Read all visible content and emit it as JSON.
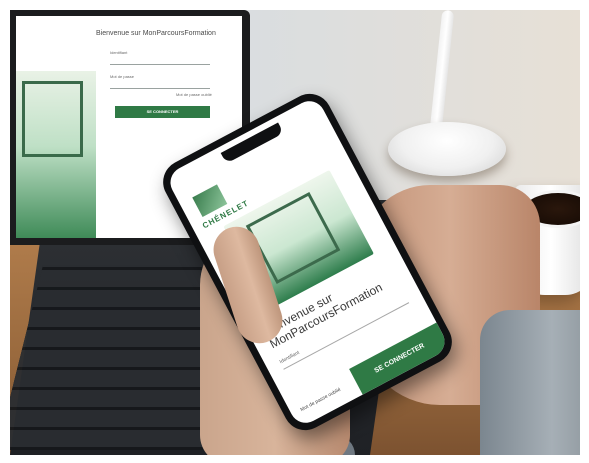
{
  "laptop_screen": {
    "title": "Bienvenue sur MonParcoursFormation",
    "field1_label": "Identifiant",
    "field2_label": "Mot de passe",
    "forgot_link": "Mot de passe oublié",
    "button": "SE CONNECTER"
  },
  "phone_screen": {
    "logo": "CHÉNELET",
    "welcome": "Bienvenue sur MonParcoursFormation",
    "field_label": "Identifiant",
    "forgot_link": "Mot de passe oublié",
    "button": "SE CONNECTER"
  },
  "colors": {
    "brand_green": "#2f7a45",
    "table_wood": "#9a6a3e"
  }
}
